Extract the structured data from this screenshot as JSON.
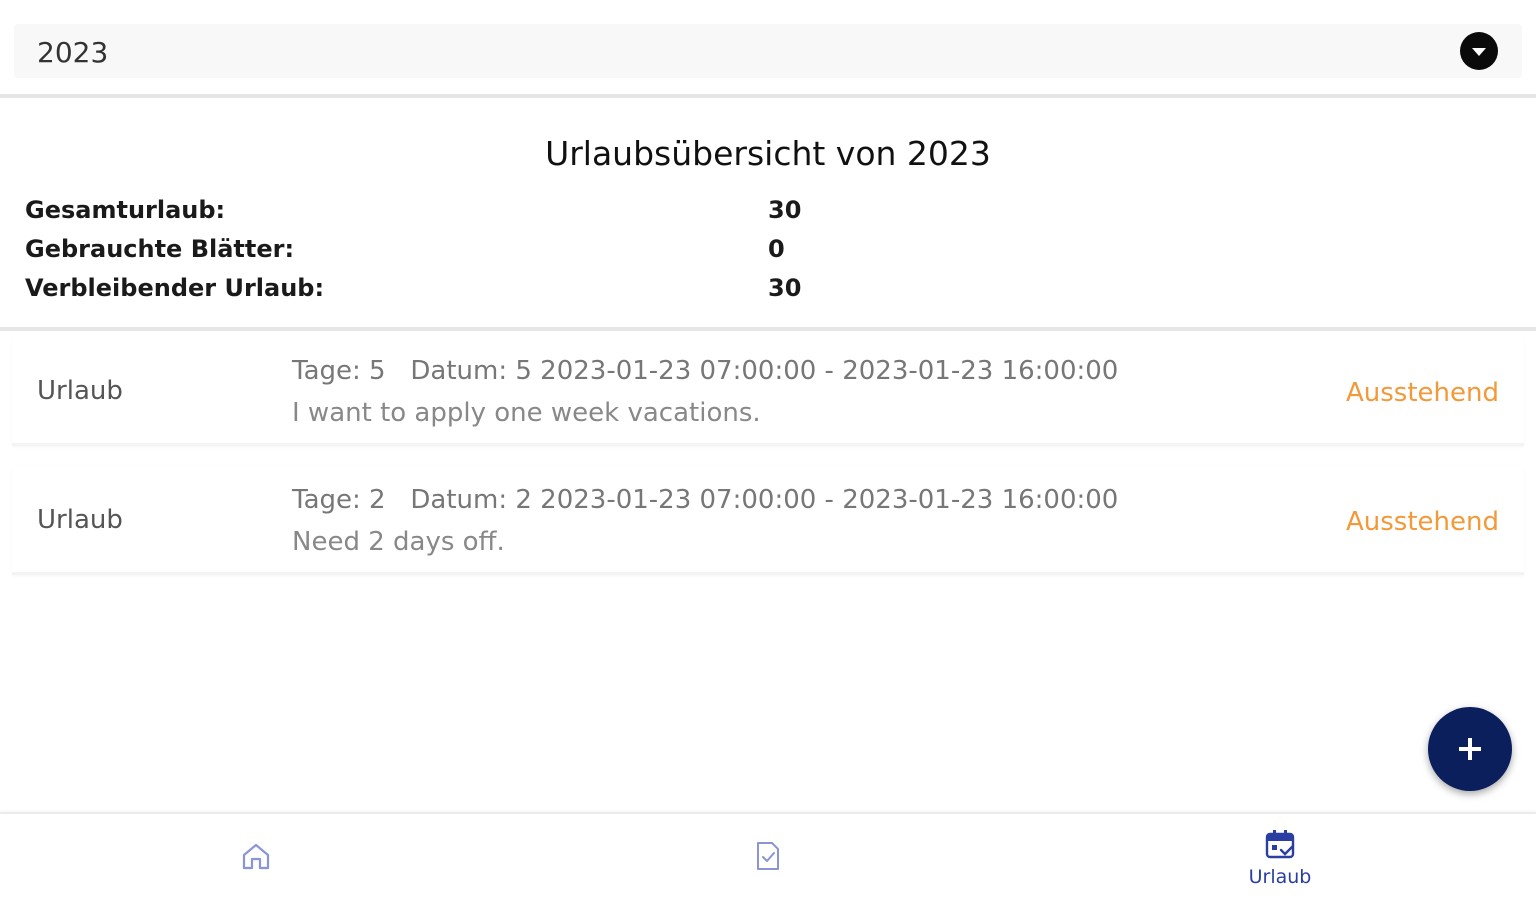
{
  "year_select": {
    "value": "2023",
    "icon": "chevron-down-circle-icon"
  },
  "overview": {
    "title": "Urlaubsübersicht von 2023",
    "rows": [
      {
        "label": "Gesamturlaub:",
        "value": "30"
      },
      {
        "label": "Gebrauchte Blätter:",
        "value": "0"
      },
      {
        "label": "Verbleibender Urlaub:",
        "value": "30"
      }
    ]
  },
  "leaves": [
    {
      "type": "Urlaub",
      "line1": "Tage: 5   Datum: 5 2023-01-23 07:00:00 - 2023-01-23 16:00:00",
      "note": "I want to apply one week vacations.",
      "status": "Ausstehend"
    },
    {
      "type": "Urlaub",
      "line1": "Tage: 2   Datum: 2 2023-01-23 07:00:00 - 2023-01-23 16:00:00",
      "note": "Need 2 days off.",
      "status": "Ausstehend"
    }
  ],
  "fab": {
    "icon": "plus-icon"
  },
  "bottom_nav": {
    "items": [
      {
        "icon": "home-icon",
        "label": ""
      },
      {
        "icon": "document-check-icon",
        "label": ""
      },
      {
        "icon": "calendar-icon",
        "label": "Urlaub"
      }
    ]
  },
  "colors": {
    "accent": "#0b1f5c",
    "status_pending": "#f2993a",
    "nav_active": "#2b3fa0",
    "nav_inactive": "#8a95d6"
  }
}
